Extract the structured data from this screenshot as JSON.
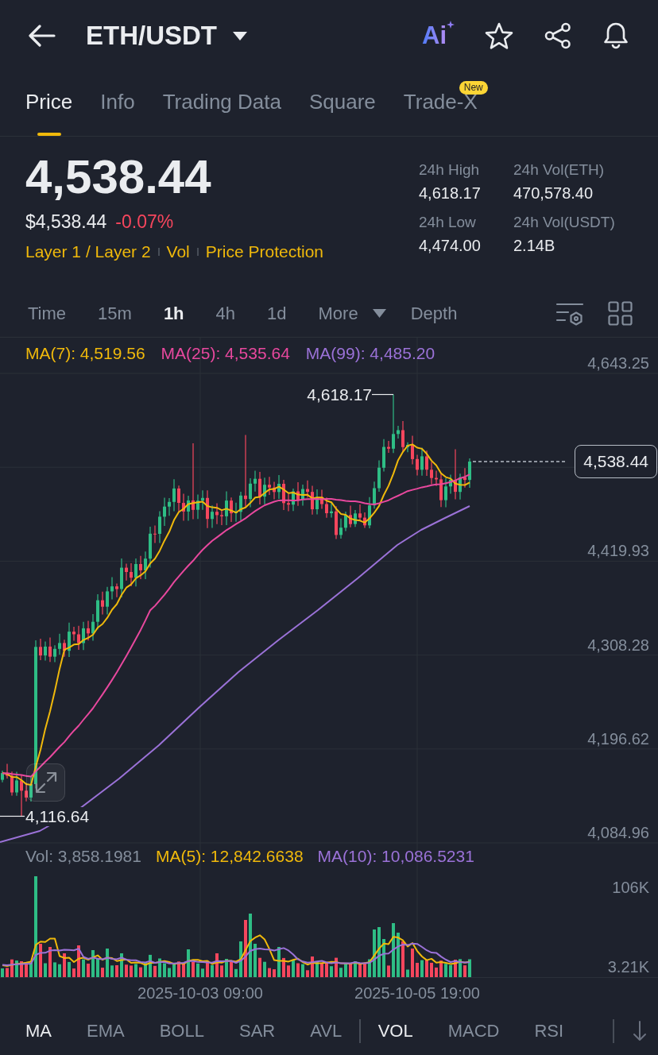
{
  "header": {
    "title": "ETH/USDT",
    "ai_label": "Ai"
  },
  "tabs": [
    {
      "label": "Price",
      "selected": true
    },
    {
      "label": "Info",
      "selected": false
    },
    {
      "label": "Trading Data",
      "selected": false
    },
    {
      "label": "Square",
      "selected": false
    },
    {
      "label": "Trade-X",
      "selected": false,
      "badge": "New"
    }
  ],
  "ticker": {
    "price": "4,538.44",
    "usd_price": "$4,538.44",
    "change": "-0.07%",
    "falling": true,
    "tags": [
      "Layer 1 / Layer 2",
      "Vol",
      "Price Protection"
    ],
    "stats": [
      {
        "label": "24h High",
        "value": "4,618.17"
      },
      {
        "label": "24h Vol(ETH)",
        "value": "470,578.40"
      },
      {
        "label": "24h Low",
        "value": "4,474.00"
      },
      {
        "label": "24h Vol(USDT)",
        "value": "2.14B"
      }
    ]
  },
  "intervals": [
    {
      "label": "Time",
      "kind": "option",
      "selected": false
    },
    {
      "label": "15m",
      "kind": "option",
      "selected": false
    },
    {
      "label": "1h",
      "kind": "option",
      "selected": true
    },
    {
      "label": "4h",
      "kind": "option",
      "selected": false
    },
    {
      "label": "1d",
      "kind": "option",
      "selected": false
    },
    {
      "label": "More",
      "kind": "dropdown",
      "selected": false
    },
    {
      "label": "Depth",
      "kind": "option",
      "selected": false
    }
  ],
  "chart": {
    "legend": [
      {
        "text": "MA(7): 4,519.56",
        "color": "#f0b90b"
      },
      {
        "text": "MA(25): 4,535.64",
        "color": "#e8489e"
      },
      {
        "text": "MA(99): 4,485.20",
        "color": "#9b72d8"
      }
    ],
    "y_labels": [
      "4,643.25",
      "4,419.93",
      "4,308.28",
      "4,196.62",
      "4,084.96"
    ],
    "high_label": "4,618.17",
    "low_label": "4,116.64",
    "last_price_tag": "4,538.44"
  },
  "volume": {
    "legend": [
      {
        "text": "Vol: 3,858.1981",
        "color": "#848e9c"
      },
      {
        "text": "MA(5): 12,842.6638",
        "color": "#f0b90b"
      },
      {
        "text": "MA(10): 10,086.5231",
        "color": "#9b72d8"
      }
    ],
    "y_labels": [
      "106K",
      "3.21K"
    ]
  },
  "x_labels": [
    "2025-10-03 09:00",
    "2025-10-05 19:00"
  ],
  "indicators": {
    "main": [
      {
        "label": "MA",
        "selected": true
      },
      {
        "label": "EMA",
        "selected": false
      },
      {
        "label": "BOLL",
        "selected": false
      },
      {
        "label": "SAR",
        "selected": false
      },
      {
        "label": "AVL",
        "selected": false
      }
    ],
    "sub": [
      {
        "label": "VOL",
        "selected": true
      },
      {
        "label": "MACD",
        "selected": false
      },
      {
        "label": "RSI",
        "selected": false
      }
    ]
  }
}
